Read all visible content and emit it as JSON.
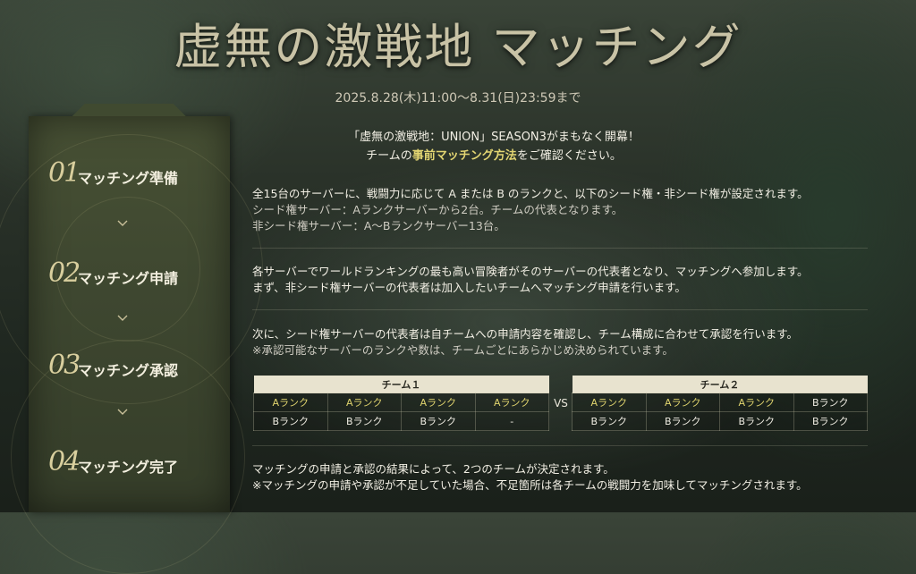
{
  "header": {
    "title": "虚無の激戦地 マッチング",
    "period": "2025.8.28(木)11:00〜8.31(日)23:59まで"
  },
  "sidebar": {
    "steps": [
      {
        "num": "01",
        "label": "マッチング準備"
      },
      {
        "num": "02",
        "label": "マッチング申請"
      },
      {
        "num": "03",
        "label": "マッチング承認"
      },
      {
        "num": "04",
        "label": "マッチング完了"
      }
    ]
  },
  "intro": {
    "line1": "「虚無の激戦地：UNION」SEASON3がまもなく開幕！",
    "line2_pre": "チームの",
    "line2_highlight": "事前マッチング方法",
    "line2_post": "をご確認ください。"
  },
  "section1": {
    "line1": "全15台のサーバーに、戦闘力に応じて A または B のランクと、以下のシード権・非シード権が設定されます。",
    "line2": "シード権サーバー：Aランクサーバーから2台。チームの代表となります。",
    "line3": "非シード権サーバー：A〜Bランクサーバー13台。"
  },
  "section2": {
    "line1": "各サーバーでワールドランキングの最も高い冒険者がそのサーバーの代表者となり、マッチングへ参加します。",
    "line2": "まず、非シード権サーバーの代表者は加入したいチームへマッチング申請を行います。"
  },
  "section3": {
    "line1": "次に、シード権サーバーの代表者は自チームへの申請内容を確認し、チーム構成に合わせて承認を行います。",
    "line2": "※承認可能なサーバーのランクや数は、チームごとにあらかじめ決められています。"
  },
  "teams": {
    "vs": "VS",
    "team1": {
      "name": "チーム１",
      "rows": [
        [
          "Aランク",
          "Aランク",
          "Aランク",
          "Aランク"
        ],
        [
          "Bランク",
          "Bランク",
          "Bランク",
          "-"
        ]
      ]
    },
    "team2": {
      "name": "チーム２",
      "rows": [
        [
          "Aランク",
          "Aランク",
          "Aランク",
          "Bランク"
        ],
        [
          "Bランク",
          "Bランク",
          "Bランク",
          "Bランク"
        ]
      ]
    }
  },
  "section4": {
    "line1": "マッチングの申請と承認の結果によって、2つのチームが決定されます。",
    "line2": "※マッチングの申請や承認が不足していた場合、不足箇所は各チームの戦闘力を加味してマッチングされます。"
  },
  "colors": {
    "accent": "#e2d572",
    "banner": "#3e4730"
  }
}
